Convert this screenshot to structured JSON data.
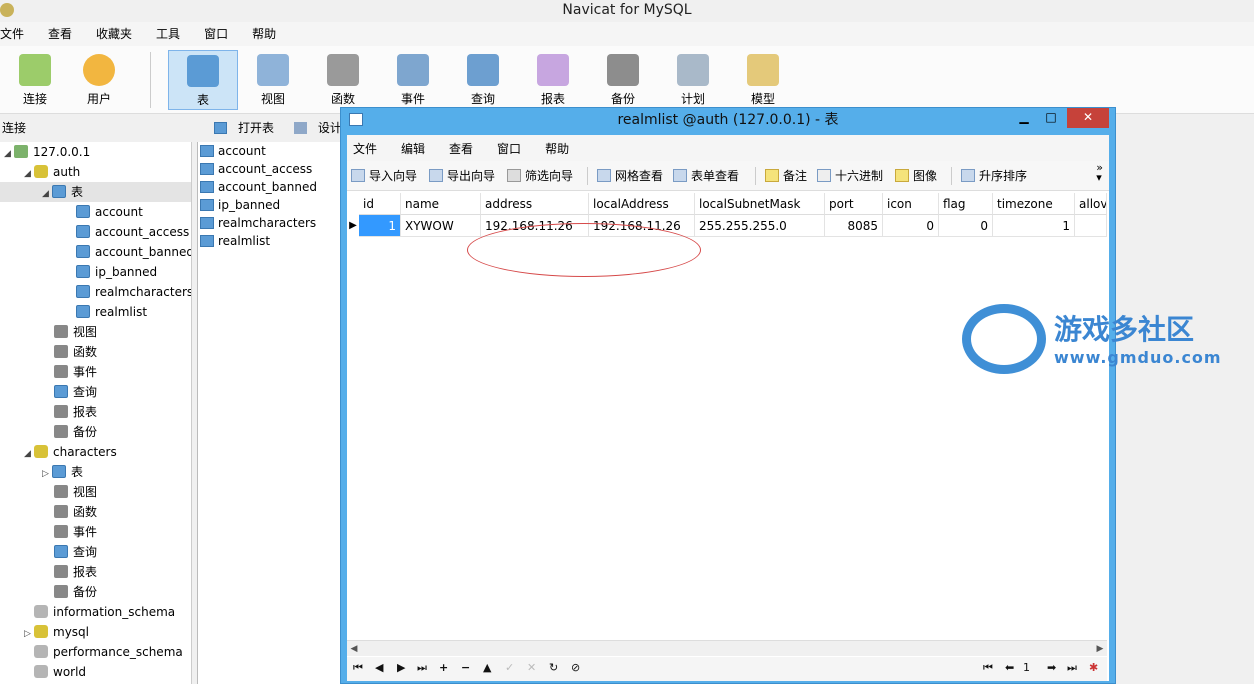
{
  "app": {
    "title": "Navicat for MySQL"
  },
  "menu": [
    "文件",
    "查看",
    "收藏夹",
    "工具",
    "窗口",
    "帮助"
  ],
  "toolbar": [
    {
      "label": "连接",
      "icon": "connection-icon"
    },
    {
      "label": "用户",
      "icon": "user-icon"
    },
    {
      "label": "表",
      "icon": "table-icon",
      "active": true
    },
    {
      "label": "视图",
      "icon": "view-icon"
    },
    {
      "label": "函数",
      "icon": "function-icon"
    },
    {
      "label": "事件",
      "icon": "event-icon"
    },
    {
      "label": "查询",
      "icon": "query-icon"
    },
    {
      "label": "报表",
      "icon": "report-icon"
    },
    {
      "label": "备份",
      "icon": "backup-icon"
    },
    {
      "label": "计划",
      "icon": "schedule-icon"
    },
    {
      "label": "模型",
      "icon": "model-icon"
    }
  ],
  "left_pane": {
    "header": "连接"
  },
  "tree": {
    "server": "127.0.0.1",
    "auth": "auth",
    "tables_group": "表",
    "tables": [
      "account",
      "account_access",
      "account_banned",
      "ip_banned",
      "realmcharacters",
      "realmlist"
    ],
    "auth_groups": [
      "视图",
      "函数",
      "事件",
      "查询",
      "报表",
      "备份"
    ],
    "characters": "characters",
    "char_groups": [
      "表",
      "视图",
      "函数",
      "事件",
      "查询",
      "报表",
      "备份"
    ],
    "other_dbs": [
      "information_schema",
      "mysql",
      "performance_schema",
      "world"
    ]
  },
  "obj_toolbar": {
    "open": "打开表",
    "design": "设计表"
  },
  "obj_list": [
    "account",
    "account_access",
    "account_banned",
    "ip_banned",
    "realmcharacters",
    "realmlist"
  ],
  "child_window": {
    "title": "realmlist @auth (127.0.0.1) - 表",
    "menu": [
      "文件",
      "编辑",
      "查看",
      "窗口",
      "帮助"
    ],
    "tools": {
      "import": "导入向导",
      "export": "导出向导",
      "filter": "筛选向导",
      "grid_view": "网格查看",
      "form_view": "表单查看",
      "memo": "备注",
      "hex": "十六进制",
      "image": "图像",
      "sort_asc": "升序排序"
    },
    "columns": [
      "id",
      "name",
      "address",
      "localAddress",
      "localSubnetMask",
      "port",
      "icon",
      "flag",
      "timezone",
      "allov"
    ],
    "row": [
      "1",
      "XYWOW",
      "192.168.11.26",
      "192.168.11.26",
      "255.255.255.0",
      "8085",
      "0",
      "0",
      "1",
      ""
    ],
    "nav_page": "1"
  },
  "watermark": {
    "title": "游戏多社区",
    "url": "www.gmduo.com"
  }
}
